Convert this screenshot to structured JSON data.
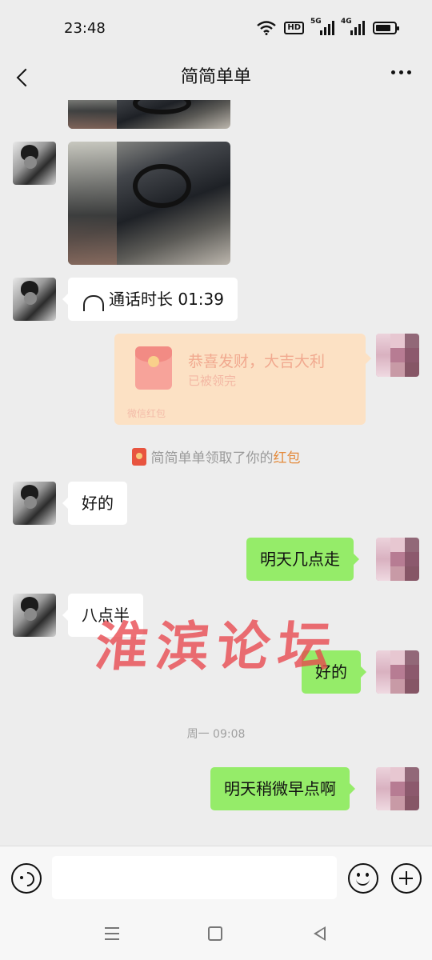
{
  "status_bar": {
    "time": "23:48",
    "hd_label": "HD",
    "sim1_label": "5G",
    "sim2_label": "4G",
    "battery_level": 0.8
  },
  "header": {
    "title": "简简单单"
  },
  "messages": {
    "call_duration": "通话时长 01:39",
    "red_packet": {
      "title": "恭喜发财，大吉大利",
      "status": "已被领完",
      "footer": "微信红包"
    },
    "system_notice": {
      "text": "简简单单领取了你的",
      "link": "红包"
    },
    "m1": "好的",
    "m2": "明天几点走",
    "m3": "八点半",
    "m4": "好的",
    "timestamp": "周一 09:08",
    "m5": "明天稍微早点啊"
  },
  "watermark": "淮滨论坛",
  "colors": {
    "sent_bubble": "#95ec69",
    "received_bubble": "#ffffff",
    "chat_bg": "#ededed",
    "watermark": "#e8474e"
  },
  "input_bar": {
    "voice_icon": "voice-icon",
    "emoji_icon": "emoji-icon",
    "plus_icon": "plus-icon"
  }
}
